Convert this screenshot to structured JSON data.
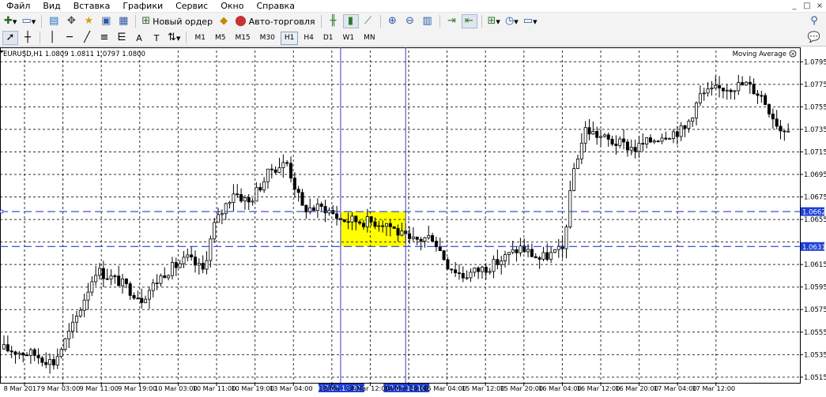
{
  "menu": {
    "items": [
      "Файл",
      "Вид",
      "Вставка",
      "Графики",
      "Сервис",
      "Окно",
      "Справка"
    ],
    "window_controls": [
      "_",
      "□",
      "×"
    ]
  },
  "toolbar": {
    "new_order_label": "Новый ордер",
    "autotrading_label": "Авто-торговля"
  },
  "toolbar2": {
    "text_tool": "A",
    "label_tool": "T",
    "timeframes": [
      "M1",
      "M5",
      "M15",
      "M30",
      "H1",
      "H4",
      "D1",
      "W1",
      "MN"
    ],
    "active_timeframe": "H1"
  },
  "chart_header": {
    "symbol_info": "EURUSD,H1  1.0809 1.0811 1.0797 1.0800",
    "indicator_label": "Moving Average"
  },
  "colors": {
    "grid": "#b0b0b0",
    "hline": "#2a3cd6",
    "vline": "#3a3ad0",
    "highlight": "#ffff00",
    "candle": "#000000"
  },
  "chart_data": {
    "type": "candlestick",
    "symbol": "EURUSD",
    "timeframe": "H1",
    "ylim": [
      1.051,
      1.0805
    ],
    "price_ticks": [
      "1.0795",
      "1.0775",
      "1.0755",
      "1.0735",
      "1.0715",
      "1.0695",
      "1.0675",
      "1.0655",
      "1.0615",
      "1.0595",
      "1.0575",
      "1.0555",
      "1.0535",
      "1.0515"
    ],
    "time_labels": [
      "8 Mar 2017",
      "9 Mar 03:00",
      "9 Mar 11:00",
      "9 Mar 19:00",
      "10 Mar 03:00",
      "10 Mar 11:00",
      "10 Mar 19:00",
      "13 Mar 04:00",
      "13 Ma",
      "14 Mar 12:00",
      "14 Mar 20:00",
      "15 Mar 04:00",
      "15 Mar 12:00",
      "15 Mar 20:00",
      "16 Mar 04:00",
      "16 Mar 12:00",
      "16 Mar 20:00",
      "17 Mar 04:00",
      "17 Mar 12:00"
    ],
    "hlines": [
      {
        "price": 1.0662,
        "label": "1.0662"
      },
      {
        "price": 1.0631,
        "label": "1.0631"
      }
    ],
    "vlines": [
      {
        "bar_index": 88,
        "label": "2017.03.13 20:00"
      },
      {
        "bar_index": 105,
        "label": "2017.03.14 10:00"
      }
    ],
    "highlight": {
      "from_bar": 88,
      "to_bar": 105,
      "price_high": 1.0662,
      "price_low": 1.0631
    },
    "anchors": [
      {
        "bar": 0,
        "price": 1.054
      },
      {
        "bar": 8,
        "price": 1.0535
      },
      {
        "bar": 13,
        "price": 1.0528
      },
      {
        "bar": 18,
        "price": 1.056
      },
      {
        "bar": 24,
        "price": 1.061
      },
      {
        "bar": 30,
        "price": 1.06
      },
      {
        "bar": 36,
        "price": 1.0585
      },
      {
        "bar": 42,
        "price": 1.0608
      },
      {
        "bar": 48,
        "price": 1.062
      },
      {
        "bar": 52,
        "price": 1.061
      },
      {
        "bar": 55,
        "price": 1.065
      },
      {
        "bar": 60,
        "price": 1.068
      },
      {
        "bar": 64,
        "price": 1.067
      },
      {
        "bar": 70,
        "price": 1.07
      },
      {
        "bar": 74,
        "price": 1.0705
      },
      {
        "bar": 78,
        "price": 1.0665
      },
      {
        "bar": 84,
        "price": 1.0665
      },
      {
        "bar": 88,
        "price": 1.0655
      },
      {
        "bar": 100,
        "price": 1.0652
      },
      {
        "bar": 106,
        "price": 1.0635
      },
      {
        "bar": 112,
        "price": 1.064
      },
      {
        "bar": 116,
        "price": 1.0615
      },
      {
        "bar": 120,
        "price": 1.0605
      },
      {
        "bar": 128,
        "price": 1.0615
      },
      {
        "bar": 135,
        "price": 1.063
      },
      {
        "bar": 140,
        "price": 1.062
      },
      {
        "bar": 146,
        "price": 1.0628
      },
      {
        "bar": 149,
        "price": 1.07
      },
      {
        "bar": 152,
        "price": 1.0735
      },
      {
        "bar": 158,
        "price": 1.0725
      },
      {
        "bar": 165,
        "price": 1.0718
      },
      {
        "bar": 172,
        "price": 1.073
      },
      {
        "bar": 178,
        "price": 1.0735
      },
      {
        "bar": 182,
        "price": 1.0765
      },
      {
        "bar": 188,
        "price": 1.0772
      },
      {
        "bar": 194,
        "price": 1.0775
      },
      {
        "bar": 198,
        "price": 1.0765
      },
      {
        "bar": 203,
        "price": 1.0735
      },
      {
        "bar": 205,
        "price": 1.0738
      }
    ]
  }
}
